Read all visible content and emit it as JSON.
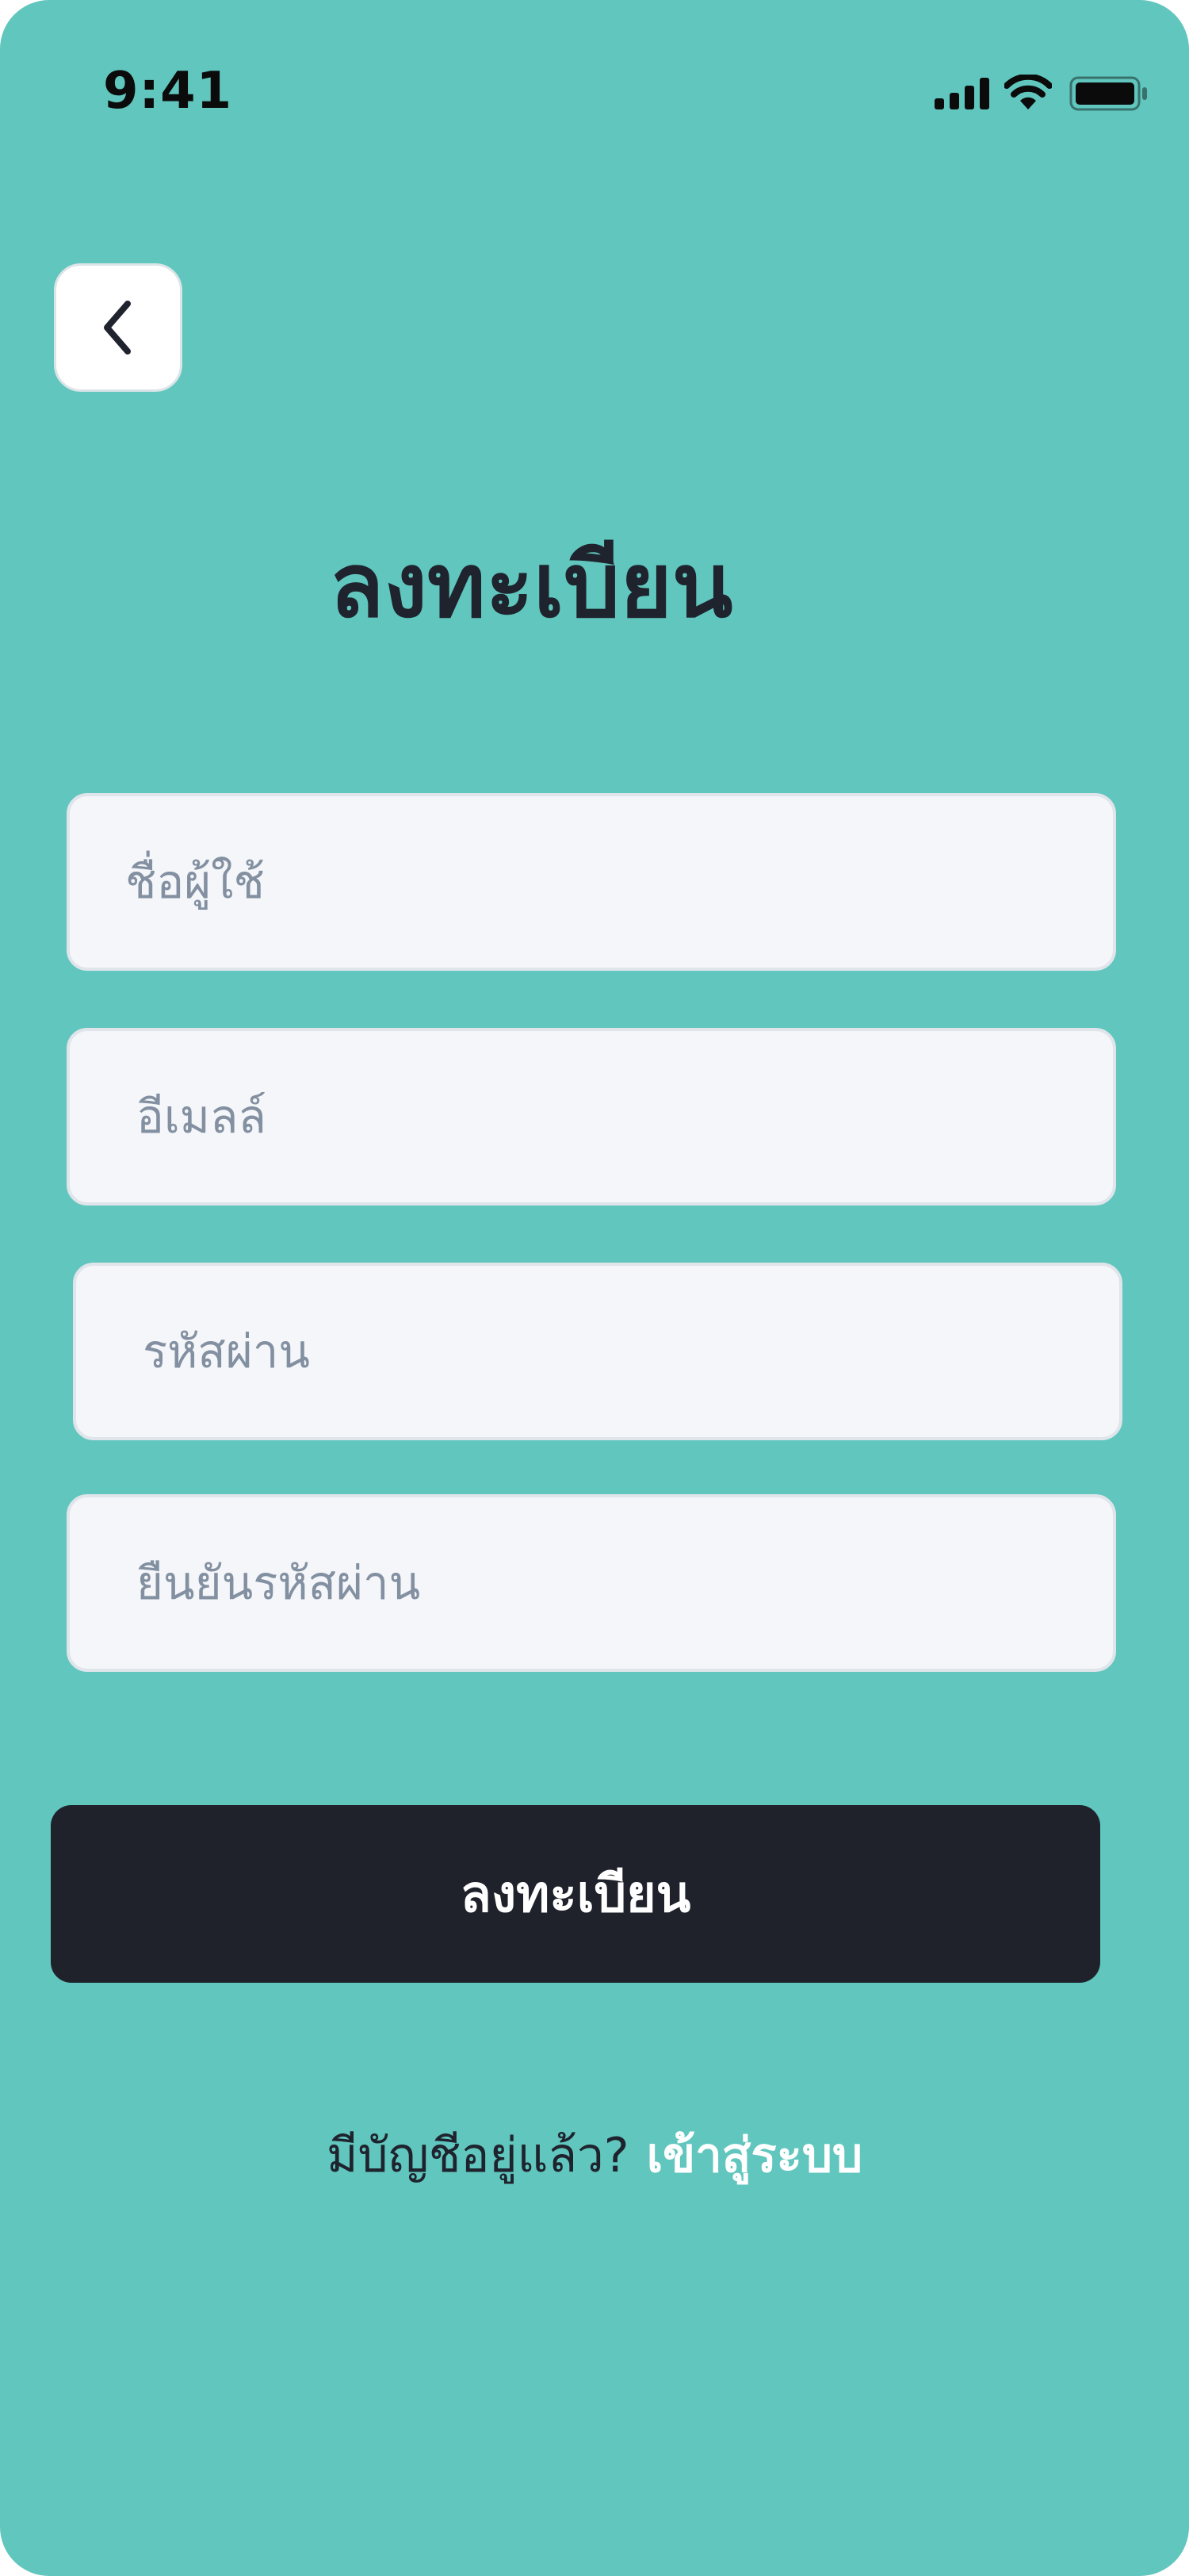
{
  "status_bar": {
    "time": "9:41"
  },
  "title": "ลงทะเบียน",
  "fields": {
    "username_placeholder": "ชื่อผู้ใช้",
    "email_placeholder": "อีเมลล์",
    "password_placeholder": "รหัสผ่าน",
    "confirm_password_placeholder": "ยืนยันรหัสผ่าน"
  },
  "register_button_label": "ลงทะเบียน",
  "footer": {
    "prompt": "มีบัญชีอยู่แล้ว?",
    "login_link": "เข้าสู่ระบบ"
  },
  "colors": {
    "background": "#60c6be",
    "button": "#1f222b",
    "field": "#f4f6f9",
    "text_dark": "#1f232d",
    "placeholder": "#8390a1"
  },
  "icons": [
    "signal-icon",
    "wifi-icon",
    "battery-icon",
    "chevron-left-icon"
  ]
}
